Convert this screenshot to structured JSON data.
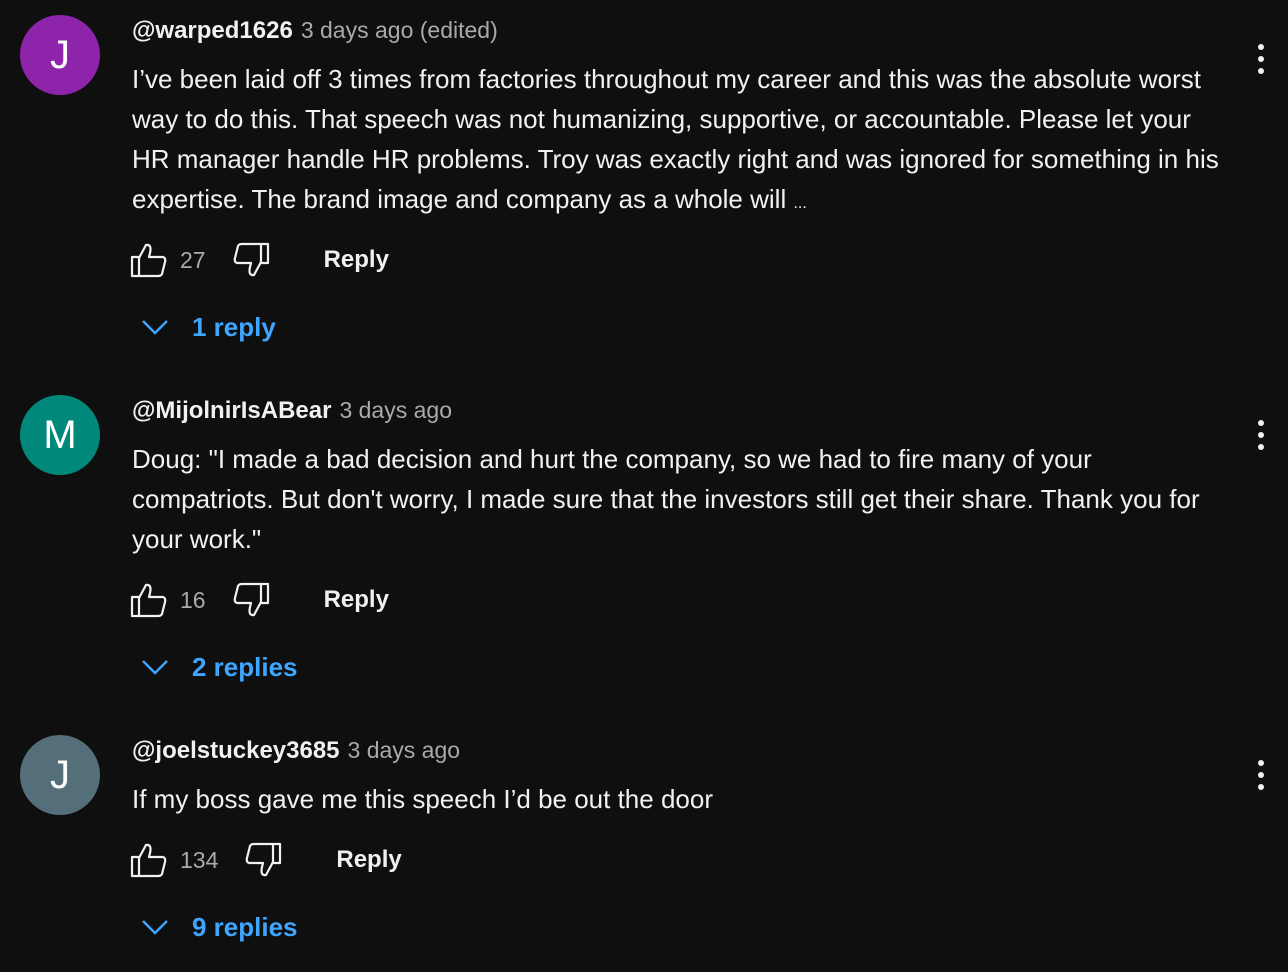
{
  "comments": [
    {
      "avatar_letter": "J",
      "avatar_color": "#8e24aa",
      "author": "@warped1626",
      "time": "3 days ago (edited)",
      "text": "I’ve been laid off 3 times from factories throughout my career and this was the absolute worst way to do this. That speech was not humanizing, supportive, or accountable. Please let your HR manager handle HR problems. Troy was exactly right and was ignored for something in his expertise. The brand image and company as a whole will",
      "ellipsis": "...",
      "likes": "27",
      "reply_label": "Reply",
      "replies_label": "1 reply"
    },
    {
      "avatar_letter": "M",
      "avatar_color": "#00897b",
      "author": "@MijolnirIsABear",
      "time": "3 days ago",
      "text": "Doug: \"I made a bad decision and hurt the company, so we had to fire many of your compatriots. But don't worry, I made sure that the investors still get their share. Thank you for your work.\"",
      "likes": "16",
      "reply_label": "Reply",
      "replies_label": "2 replies"
    },
    {
      "avatar_letter": "J",
      "avatar_color": "#546e7a",
      "author": "@joelstuckey3685",
      "time": "3 days ago",
      "text": "If my boss gave me this speech I’d be out the door",
      "likes": "134",
      "reply_label": "Reply",
      "replies_label": "9 replies"
    }
  ],
  "icons": {
    "like": "thumbs-up-icon",
    "dislike": "thumbs-down-icon",
    "menu": "more-vert-icon",
    "expand": "chevron-down-icon"
  },
  "colors": {
    "background": "#0f0f0f",
    "text": "#f1f1f1",
    "secondary_text": "#aaaaaa",
    "link": "#3ea6ff"
  }
}
